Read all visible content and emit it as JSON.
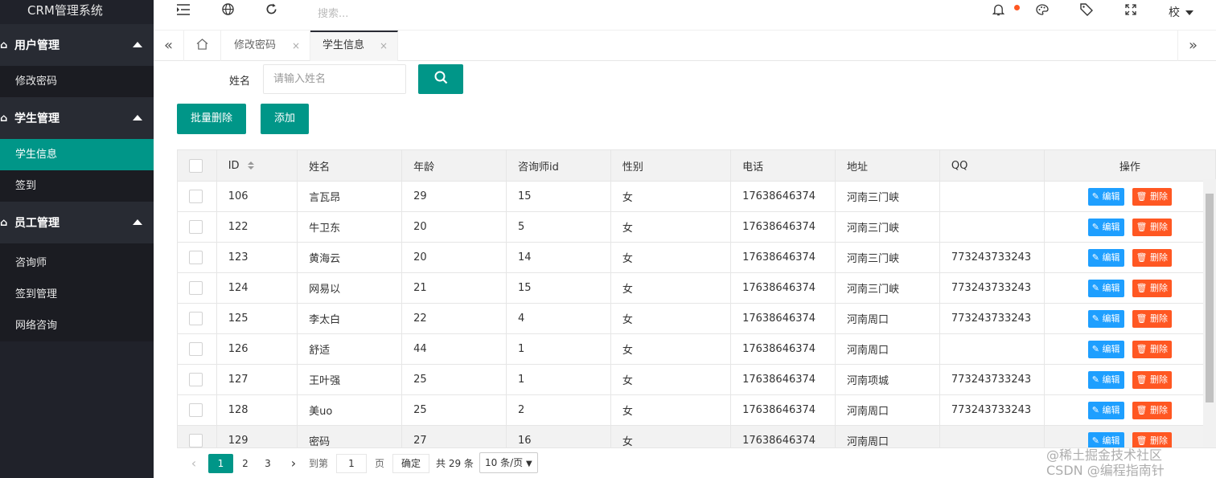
{
  "app": {
    "title": "CRM管理系统"
  },
  "sidebar": {
    "groups": [
      {
        "label": "用户管理",
        "items": [
          {
            "label": "修改密码"
          }
        ]
      },
      {
        "label": "学生管理",
        "items": [
          {
            "label": "学生信息",
            "active": true
          },
          {
            "label": "签到"
          }
        ]
      },
      {
        "label": "员工管理",
        "items": [
          {
            "label": "咨询师"
          },
          {
            "label": "签到管理"
          },
          {
            "label": "网络咨询"
          }
        ]
      }
    ]
  },
  "header": {
    "search_placeholder": "搜索...",
    "user_label": "校",
    "icons": [
      "menu-fold-icon",
      "globe-icon",
      "refresh-icon",
      "bell-icon",
      "palette-icon",
      "tag-icon",
      "fullscreen-icon"
    ]
  },
  "tabs": [
    {
      "label": "修改密码",
      "close": "×",
      "active": false
    },
    {
      "label": "学生信息",
      "close": "×",
      "active": true
    }
  ],
  "filter": {
    "name_label": "姓名",
    "name_placeholder": "请输入姓名"
  },
  "actions": {
    "batch_delete": "批量删除",
    "add": "添加"
  },
  "table": {
    "columns": [
      "ID",
      "姓名",
      "年龄",
      "咨询师id",
      "性别",
      "电话",
      "地址",
      "QQ",
      "操作"
    ],
    "edit_label": "编辑",
    "delete_label": "删除",
    "rows": [
      {
        "id": "106",
        "name": "言瓦昂",
        "age": "29",
        "counselor": "15",
        "gender": "女",
        "phone": "17638646374",
        "address": "河南三门峡",
        "qq": ""
      },
      {
        "id": "122",
        "name": "牛卫东",
        "age": "20",
        "counselor": "5",
        "gender": "女",
        "phone": "17638646374",
        "address": "河南三门峡",
        "qq": ""
      },
      {
        "id": "123",
        "name": "黄海云",
        "age": "20",
        "counselor": "14",
        "gender": "女",
        "phone": "17638646374",
        "address": "河南三门峡",
        "qq": "773243733243"
      },
      {
        "id": "124",
        "name": "网易以",
        "age": "21",
        "counselor": "15",
        "gender": "女",
        "phone": "17638646374",
        "address": "河南三门峡",
        "qq": "773243733243"
      },
      {
        "id": "125",
        "name": "李太白",
        "age": "22",
        "counselor": "4",
        "gender": "女",
        "phone": "17638646374",
        "address": "河南周口",
        "qq": "773243733243"
      },
      {
        "id": "126",
        "name": "舒适",
        "age": "44",
        "counselor": "1",
        "gender": "女",
        "phone": "17638646374",
        "address": "河南周口",
        "qq": ""
      },
      {
        "id": "127",
        "name": "王叶强",
        "age": "25",
        "counselor": "1",
        "gender": "女",
        "phone": "17638646374",
        "address": "河南项城",
        "qq": "773243733243"
      },
      {
        "id": "128",
        "name": "美uo",
        "age": "25",
        "counselor": "2",
        "gender": "女",
        "phone": "17638646374",
        "address": "河南周口",
        "qq": "773243733243"
      },
      {
        "id": "129",
        "name": "密码",
        "age": "27",
        "counselor": "16",
        "gender": "女",
        "phone": "17638646374",
        "address": "河南周口",
        "qq": ""
      }
    ]
  },
  "pagination": {
    "prev": "‹",
    "pages": [
      "1",
      "2",
      "3"
    ],
    "current": "1",
    "next": "›",
    "goto_label": "到第",
    "goto_value": "1",
    "page_unit": "页",
    "confirm": "确定",
    "total": "共 29 条",
    "page_size": "10 条/页"
  },
  "watermark": {
    "line1": "@稀土掘金技术社区",
    "line2": "CSDN @编程指南针"
  },
  "colors": {
    "accent": "#009688",
    "sidebar_bg": "#20222a",
    "edit_blue": "#1e9fff",
    "delete_orange": "#ff5722"
  }
}
